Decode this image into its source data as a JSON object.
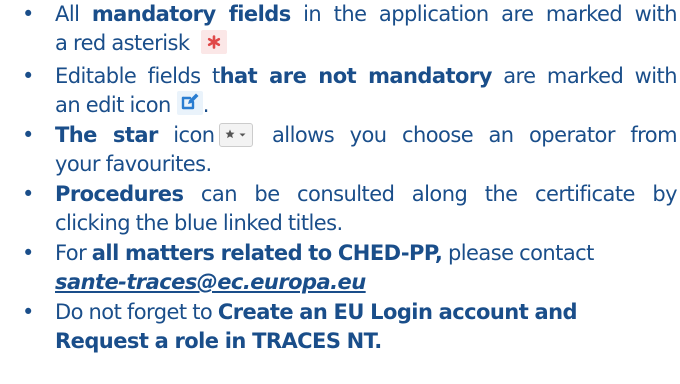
{
  "bullet_glyph": "•",
  "items": [
    {
      "lines": [
        {
          "p1": "All ",
          "b1": "mandatory fields",
          "p2": " in the application are marked with"
        },
        {
          "p1": "a red asterisk"
        }
      ],
      "icon": "asterisk-icon",
      "icon_color": "#e04848"
    },
    {
      "lines": [
        {
          "p1": "Editable fields t",
          "b1": "hat are not mandatory",
          "p2": " are marked with"
        },
        {
          "p1": "an edit icon",
          "p2": "."
        }
      ],
      "icon": "edit-icon",
      "icon_color": "#2a7dd1"
    },
    {
      "lines": [
        {
          "b1": "The star",
          "p1": " icon",
          "p2": " allows you choose an operator from"
        },
        {
          "p1": "your favourites."
        }
      ],
      "icon": "star-icon",
      "icon_color": "#555555"
    },
    {
      "lines": [
        {
          "b1": "Procedures",
          "p1": " can be consulted along the certificate by"
        },
        {
          "p1": "clicking the blue linked titles."
        }
      ]
    },
    {
      "lines": [
        {
          "p1": "For ",
          "b1": "all matters related to CHED-PP,",
          "p2": " please contact"
        }
      ],
      "link": "sante-traces@ec.europa.eu"
    },
    {
      "lines": [
        {
          "p1": "Do not forget to ",
          "b1": "Create an EU Login account and"
        },
        {
          "b1": "Request a role in TRACES NT."
        }
      ]
    }
  ],
  "colors": {
    "text": "#1a4e8a",
    "asterisk": "#e04848",
    "edit": "#2a7dd1"
  }
}
